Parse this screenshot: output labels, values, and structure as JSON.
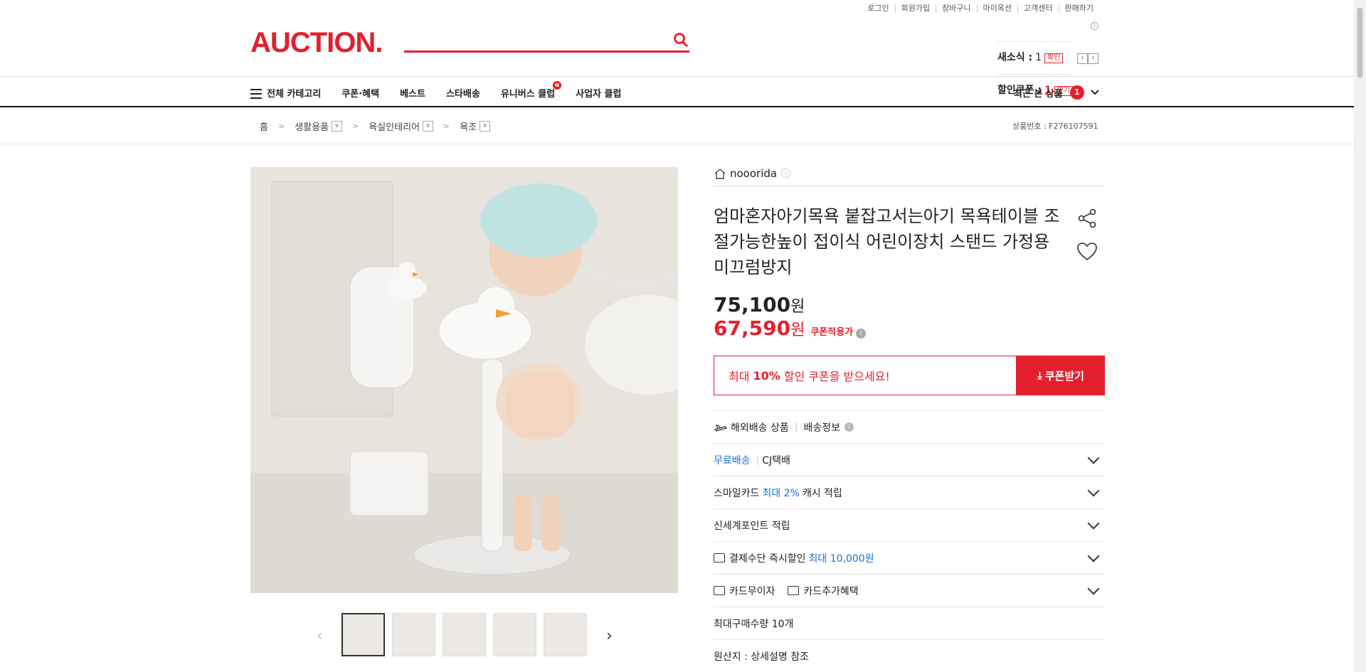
{
  "util_links": [
    "로그인",
    "회원가입",
    "장바구니",
    "마이옥션",
    "고객센터",
    "판매하기"
  ],
  "logo": "AUCTION.",
  "status": {
    "new_label": "새소식 :",
    "new_count": "1",
    "new_btn": "확인",
    "coupon_label": "할인쿠폰 :",
    "coupon_count": "1",
    "coupon_btn": "받기"
  },
  "nav": {
    "all_categories": "전체 카테고리",
    "items": [
      "쿠폰·혜택",
      "베스트",
      "스타배송",
      "유니버스 클럽",
      "사업자 클럽"
    ],
    "new_badge": "N",
    "recent_label": "최근 본 상품",
    "recent_count": "1"
  },
  "breadcrumb": {
    "home": "홈",
    "items": [
      "생활용품",
      "욕실인테리어",
      "욕조"
    ],
    "product_no": "상품번호 : F276107591"
  },
  "product": {
    "seller": "nooorida",
    "title": "엄마혼자아기목욕 붙잡고서는아기 목욕테이블 조절가능한높이 접이식 어린이장치 스탠드 가정용 미끄럼방지",
    "price_original": "75,100",
    "price_sale": "67,590",
    "won": "원",
    "coupon_price_label": "쿠폰적용가",
    "coupon_msg_pre": "최대",
    "coupon_msg_pct": "10%",
    "coupon_msg_post": "할인 쿠폰을 받으세요!",
    "coupon_btn": "쿠폰받기"
  },
  "rows": {
    "overseas": "해외배송 상품",
    "shipping_info": "배송정보",
    "free_ship": "무료배송",
    "courier": "CJ택배",
    "smile_pre": "스마일카드",
    "smile_blue": "최대 2%",
    "smile_post": "캐시 적립",
    "shinsegae": "신세계포인트 적립",
    "pay_pre": "결제수단 즉시할인",
    "pay_blue": "최대 10,000원",
    "card_noint": "카드무이자",
    "card_extra": "카드추가혜택",
    "max_qty": "최대구매수량 10개",
    "origin": "원산지 : 상세설명 참조"
  },
  "colors": {
    "accent": "#e4202d",
    "blue": "#1d6fd7"
  }
}
